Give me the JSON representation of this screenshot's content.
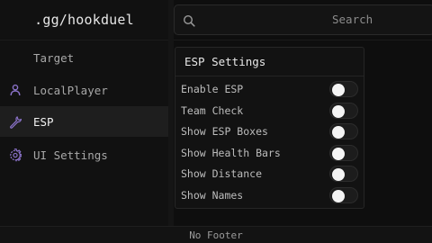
{
  "brand": {
    "title": ".gg/hookduel"
  },
  "search": {
    "placeholder": "Search",
    "icon": "search-icon"
  },
  "sidebar": {
    "items": [
      {
        "label": "Target",
        "icon": "",
        "active": false
      },
      {
        "label": "LocalPlayer",
        "icon": "user-icon",
        "active": false
      },
      {
        "label": "ESP",
        "icon": "wrench-icon",
        "active": true
      },
      {
        "label": "UI Settings",
        "icon": "gear-icon",
        "active": false
      }
    ]
  },
  "panel": {
    "title": "ESP Settings",
    "options": [
      {
        "label": "Enable ESP",
        "enabled": false
      },
      {
        "label": "Team Check",
        "enabled": false
      },
      {
        "label": "Show ESP Boxes",
        "enabled": false
      },
      {
        "label": "Show Health Bars",
        "enabled": false
      },
      {
        "label": "Show Distance",
        "enabled": false
      },
      {
        "label": "Show Names",
        "enabled": false
      }
    ]
  },
  "footer": {
    "text": "No Footer"
  },
  "colors": {
    "accent": "#8a72c8",
    "background": "#0e0e0e",
    "sidebar": "#111111",
    "active_item": "#1e1e1e"
  }
}
